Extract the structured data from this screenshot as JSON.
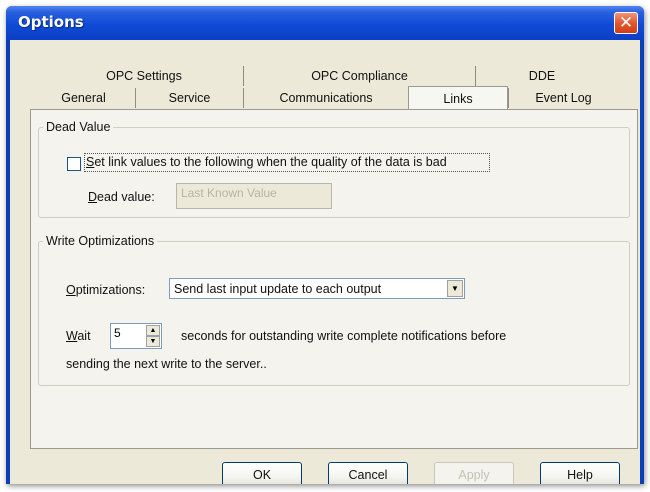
{
  "window": {
    "title": "Options"
  },
  "tabs": {
    "row1": [
      "OPC Settings",
      "OPC Compliance",
      "DDE"
    ],
    "row2": [
      "General",
      "Service",
      "Communications",
      "Links",
      "Event Log"
    ],
    "active": "Links"
  },
  "dead_value": {
    "group_label": "Dead Value",
    "checkbox_label_mnemonic": "S",
    "checkbox_label_rest": "et link values to the following when the quality of the data is bad",
    "checked": false,
    "field_label_mnemonic": "D",
    "field_label_rest": "ead value:",
    "field_value": "Last Known Value"
  },
  "write_optimizations": {
    "group_label": "Write Optimizations",
    "optimizations_label_mnemonic": "O",
    "optimizations_label_rest": "ptimizations:",
    "optimizations_value": "Send last input update to each output",
    "wait_label_mnemonic": "W",
    "wait_label_rest": "ait",
    "wait_value": "5",
    "wait_text_line1": "seconds for outstanding write complete notifications before",
    "wait_text_line2": "sending the next write to the server.."
  },
  "buttons": {
    "ok": "OK",
    "cancel": "Cancel",
    "apply": "Apply",
    "help": "Help"
  }
}
